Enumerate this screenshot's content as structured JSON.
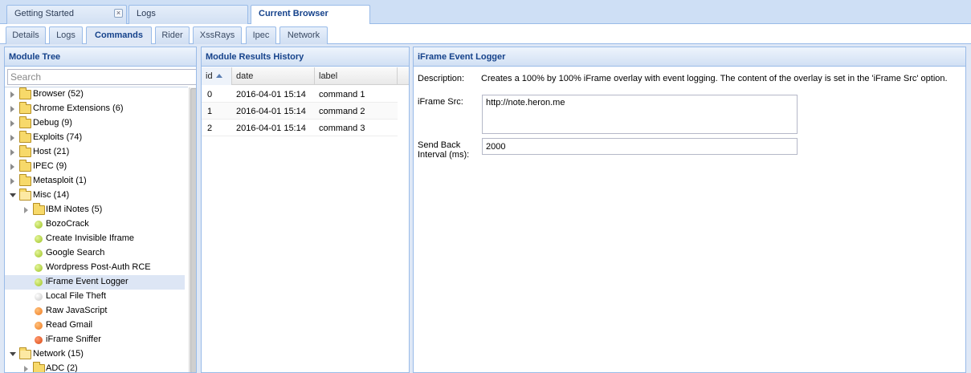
{
  "top_tabs": [
    {
      "label": "Getting Started",
      "closable": true,
      "active": false
    },
    {
      "label": "Logs",
      "active": false
    },
    {
      "label": "Current Browser",
      "active": true
    }
  ],
  "sub_tabs": [
    {
      "label": "Details",
      "active": false
    },
    {
      "label": "Logs",
      "active": false
    },
    {
      "label": "Commands",
      "active": true
    },
    {
      "label": "Rider",
      "active": false
    },
    {
      "label": "XssRays",
      "active": false
    },
    {
      "label": "Ipec",
      "active": false
    },
    {
      "label": "Network",
      "active": false
    }
  ],
  "module_tree": {
    "title": "Module Tree",
    "search_placeholder": "Search",
    "items": [
      {
        "label": "Browser (52)",
        "type": "folder",
        "expanded": false,
        "level": 0
      },
      {
        "label": "Chrome Extensions (6)",
        "type": "folder",
        "expanded": false,
        "level": 0
      },
      {
        "label": "Debug (9)",
        "type": "folder",
        "expanded": false,
        "level": 0
      },
      {
        "label": "Exploits (74)",
        "type": "folder",
        "expanded": false,
        "level": 0
      },
      {
        "label": "Host (21)",
        "type": "folder",
        "expanded": false,
        "level": 0
      },
      {
        "label": "IPEC (9)",
        "type": "folder",
        "expanded": false,
        "level": 0
      },
      {
        "label": "Metasploit (1)",
        "type": "folder",
        "expanded": false,
        "level": 0
      },
      {
        "label": "Misc (14)",
        "type": "folder",
        "expanded": true,
        "level": 0
      },
      {
        "label": "IBM iNotes (5)",
        "type": "folder",
        "expanded": false,
        "level": 1
      },
      {
        "label": "BozoCrack",
        "type": "module",
        "status": "green",
        "level": 1
      },
      {
        "label": "Create Invisible Iframe",
        "type": "module",
        "status": "green",
        "level": 1
      },
      {
        "label": "Google Search",
        "type": "module",
        "status": "green",
        "level": 1
      },
      {
        "label": "Wordpress Post-Auth RCE",
        "type": "module",
        "status": "green",
        "level": 1
      },
      {
        "label": "iFrame Event Logger",
        "type": "module",
        "status": "green",
        "level": 1,
        "selected": true
      },
      {
        "label": "Local File Theft",
        "type": "module",
        "status": "white",
        "level": 1
      },
      {
        "label": "Raw JavaScript",
        "type": "module",
        "status": "orange",
        "level": 1
      },
      {
        "label": "Read Gmail",
        "type": "module",
        "status": "orange",
        "level": 1
      },
      {
        "label": "iFrame Sniffer",
        "type": "module",
        "status": "red",
        "level": 1
      },
      {
        "label": "Network (15)",
        "type": "folder",
        "expanded": true,
        "level": 0
      },
      {
        "label": "ADC (2)",
        "type": "folder",
        "expanded": false,
        "level": 1
      }
    ]
  },
  "results_history": {
    "title": "Module Results History",
    "columns": [
      "id",
      "date",
      "label"
    ],
    "sort_column": "id",
    "rows": [
      {
        "id": "0",
        "date": "2016-04-01 15:14",
        "label": "command 1"
      },
      {
        "id": "1",
        "date": "2016-04-01 15:14",
        "label": "command 2"
      },
      {
        "id": "2",
        "date": "2016-04-01 15:14",
        "label": "command 3"
      }
    ]
  },
  "module_detail": {
    "title": "iFrame Event Logger",
    "description_label": "Description:",
    "description": "Creates a 100% by 100% iFrame overlay with event logging. The content of the overlay is set in the 'iFrame Src' option.",
    "iframe_src_label": "iFrame Src:",
    "iframe_src_value": "http://note.heron.me",
    "interval_label_line1": "Send Back",
    "interval_label_line2": "Interval (ms):",
    "interval_value": "2000"
  },
  "colors": {
    "header_text": "#15428b",
    "border": "#99bbe8",
    "background": "#dfe8f6"
  }
}
